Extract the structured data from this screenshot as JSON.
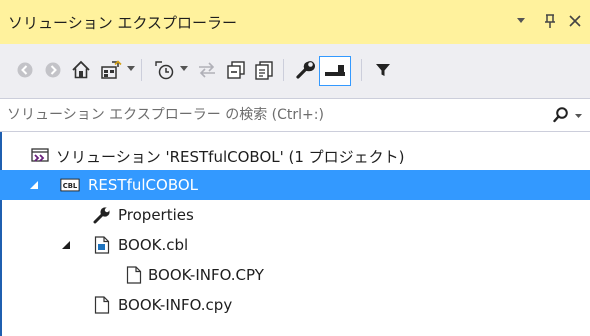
{
  "panel": {
    "title": "ソリューション エクスプローラー",
    "title_buttons": [
      "dropdown-arrow-icon",
      "pin-icon",
      "close-icon"
    ]
  },
  "toolbar": {
    "buttons": [
      "back-icon",
      "forward-icon",
      "home-icon",
      "switch-views-icon",
      "pending-changes-filter-icon",
      "sync-with-active-document-icon",
      "collapse-all-icon",
      "show-all-files-icon",
      "properties-icon",
      "preview-selected-items-icon",
      "filter-icon"
    ]
  },
  "search": {
    "placeholder": "ソリューション エクスプローラー の検索 (Ctrl+:)"
  },
  "tree": {
    "items": [
      {
        "label": "ソリューション 'RESTfulCOBOL' (1 プロジェクト)",
        "icon": "solution-icon",
        "expanded": null
      },
      {
        "label": "RESTfulCOBOL",
        "icon": "cobol-project-icon",
        "expanded": true,
        "selected": true
      },
      {
        "label": "Properties",
        "icon": "wrench-icon",
        "expanded": null
      },
      {
        "label": "BOOK.cbl",
        "icon": "cobol-source-file-icon",
        "expanded": true
      },
      {
        "label": "BOOK-INFO.CPY",
        "icon": "file-icon",
        "expanded": null
      },
      {
        "label": "BOOK-INFO.cpy",
        "icon": "file-icon",
        "expanded": null
      }
    ]
  },
  "colors": {
    "title_bar": "#fff29d",
    "selection": "#3399ff",
    "toolbar": "#eeeef2"
  }
}
